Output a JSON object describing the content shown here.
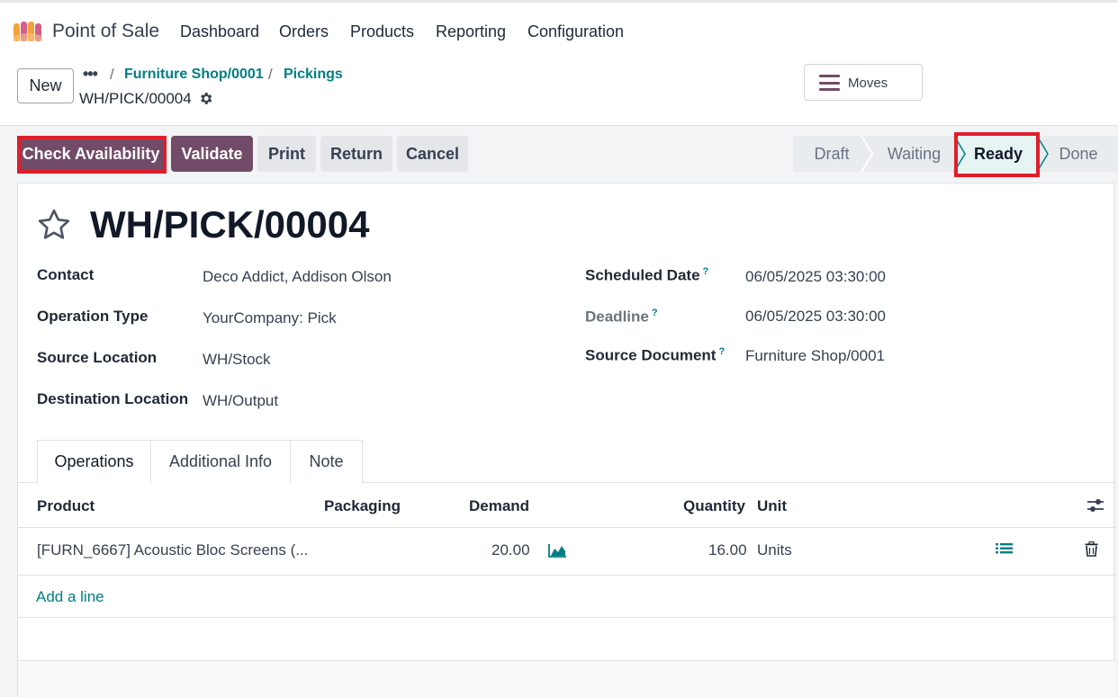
{
  "app": {
    "name": "Point of Sale"
  },
  "menu": [
    "Dashboard",
    "Orders",
    "Products",
    "Reporting",
    "Configuration"
  ],
  "control": {
    "new_label": "New",
    "breadcrumbs": [
      "Furniture Shop/0001",
      "Pickings"
    ],
    "record_name": "WH/PICK/00004",
    "moves_label": "Moves"
  },
  "actions": [
    "Check Availability",
    "Validate",
    "Print",
    "Return",
    "Cancel"
  ],
  "stages": {
    "items": [
      "Draft",
      "Waiting",
      "Ready",
      "Done"
    ],
    "active": "Ready"
  },
  "record": {
    "title": "WH/PICK/00004",
    "fields_left": [
      {
        "label": "Contact",
        "value": "Deco Addict, Addison Olson"
      },
      {
        "label": "Operation Type",
        "value": "YourCompany: Pick"
      },
      {
        "label": "Source Location",
        "value": "WH/Stock"
      },
      {
        "label": "Destination Location",
        "value": "WH/Output"
      }
    ],
    "fields_right": [
      {
        "label": "Scheduled Date",
        "help": "?",
        "value": "06/05/2025 03:30:00"
      },
      {
        "label": "Deadline",
        "help": "?",
        "value": "06/05/2025 03:30:00"
      },
      {
        "label": "Source Document",
        "help": "?",
        "value": "Furniture Shop/0001"
      }
    ]
  },
  "tabs": [
    "Operations",
    "Additional Info",
    "Note"
  ],
  "table": {
    "columns": [
      "Product",
      "Packaging",
      "Demand",
      "Quantity",
      "Unit"
    ],
    "rows": [
      {
        "product": "[FURN_6667] Acoustic Bloc Screens (...",
        "packaging": "",
        "demand": "20.00",
        "quantity": "16.00",
        "unit": "Units"
      }
    ],
    "add_line": "Add a line"
  },
  "colors": {
    "primary": "#714b67",
    "link": "#017e84",
    "highlight": "#e11d2a"
  },
  "icons": [
    "app-logo-icon",
    "ellipsis-icon",
    "gear-icon",
    "hamburger-icon",
    "star-icon",
    "forecast-chart-icon",
    "details-list-icon",
    "trash-icon",
    "column-settings-icon"
  ]
}
